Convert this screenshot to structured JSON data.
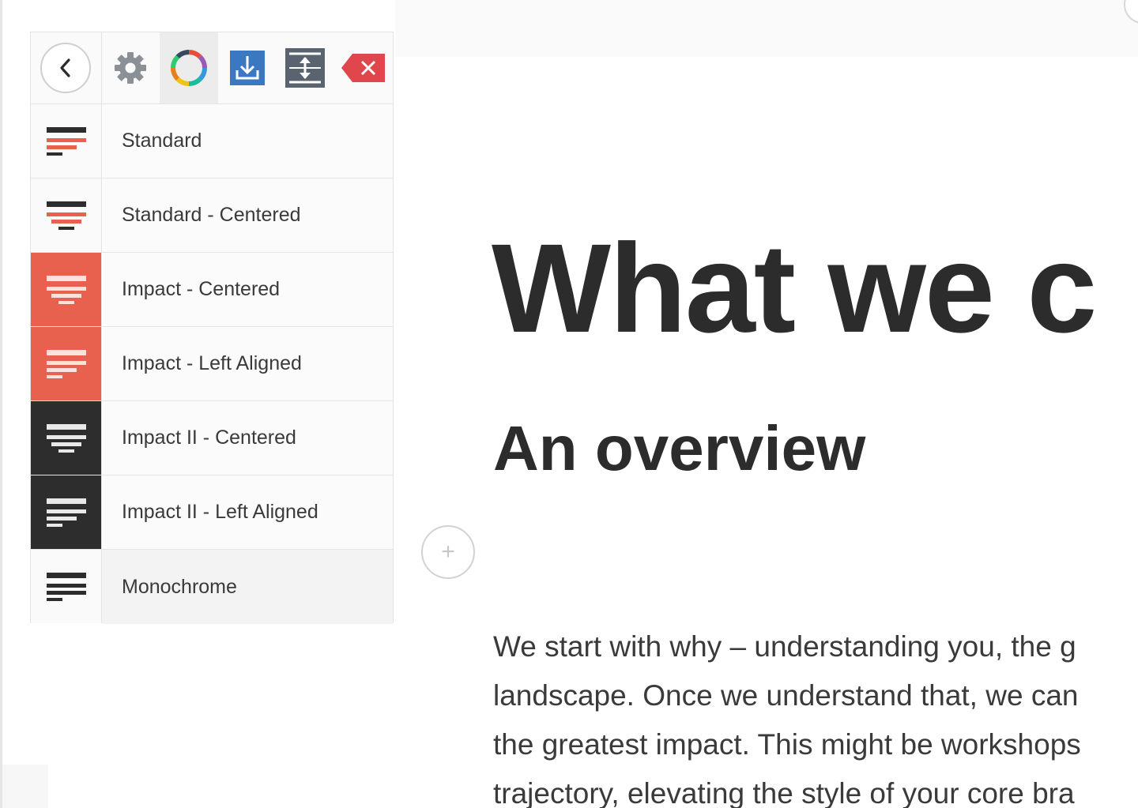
{
  "toolbar": {
    "buttons": [
      {
        "name": "back",
        "icon": "back-arrow-icon"
      },
      {
        "name": "settings",
        "icon": "gear-icon"
      },
      {
        "name": "colors",
        "icon": "color-wheel-icon",
        "active": true
      },
      {
        "name": "download",
        "icon": "download-icon"
      },
      {
        "name": "resize",
        "icon": "vertical-resize-icon"
      },
      {
        "name": "delete",
        "icon": "delete-icon"
      }
    ]
  },
  "styles": [
    {
      "label": "Standard",
      "variant": "standard"
    },
    {
      "label": "Standard - Centered",
      "variant": "standard-centered"
    },
    {
      "label": "Impact - Centered",
      "variant": "impact-centered"
    },
    {
      "label": "Impact - Left Aligned",
      "variant": "impact-left"
    },
    {
      "label": "Impact II - Centered",
      "variant": "impact2-centered"
    },
    {
      "label": "Impact II - Left Aligned",
      "variant": "impact2-left"
    },
    {
      "label": "Monochrome",
      "variant": "monochrome",
      "selected": true
    }
  ],
  "content": {
    "hero_title": "What we c",
    "subtitle": "An overview",
    "add_button": "+",
    "body_lines": [
      "We start with why – understanding you, the g",
      "landscape. Once we understand that, we can",
      "the greatest impact. This might be workshops",
      "trajectory, elevating the style of your core bra"
    ]
  },
  "colors": {
    "accent_red": "#e8614f",
    "dark": "#2d2d2d",
    "download_blue": "#3a78c2",
    "resize_gray": "#5a6470",
    "delete_red": "#e0474c"
  }
}
